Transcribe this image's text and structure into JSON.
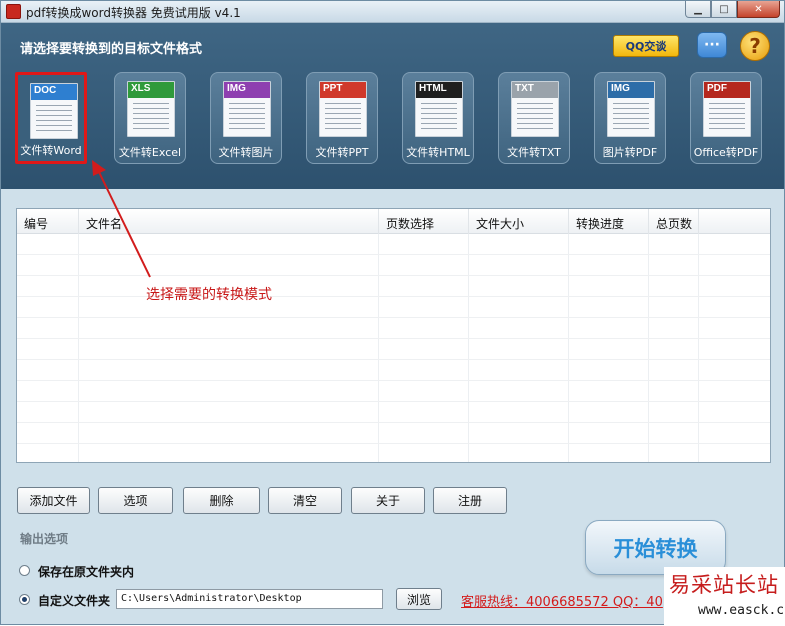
{
  "window": {
    "title": "pdf转换成word转换器 免费试用版 v4.1"
  },
  "header": {
    "title": "请选择要转换到的目标文件格式",
    "qq_chat_label": "QQ交谈",
    "chat_icon": "speech-bubble-icon",
    "help_icon": "question-icon"
  },
  "modes": [
    {
      "badge": "DOC",
      "label": "文件转Word",
      "selected": true,
      "band_color": "#2e7fd0"
    },
    {
      "badge": "XLS",
      "label": "文件转Excel",
      "selected": false,
      "band_color": "#2f9a3b"
    },
    {
      "badge": "IMG",
      "label": "文件转图片",
      "selected": false,
      "band_color": "#8e3fb0"
    },
    {
      "badge": "PPT",
      "label": "文件转PPT",
      "selected": false,
      "band_color": "#d0392b"
    },
    {
      "badge": "HTML",
      "label": "文件转HTML",
      "selected": false,
      "band_color": "#1f1f1f"
    },
    {
      "badge": "TXT",
      "label": "文件转TXT",
      "selected": false,
      "band_color": "#9aa3ab"
    },
    {
      "badge": "IMG",
      "label": "图片转PDF",
      "selected": false,
      "band_color": "#2d6da8"
    },
    {
      "badge": "PDF",
      "label": "Office转PDF",
      "selected": false,
      "band_color": "#b5281e"
    }
  ],
  "table": {
    "columns": [
      "编号",
      "文件名",
      "页数选择",
      "文件大小",
      "转换进度",
      "总页数"
    ],
    "rows": []
  },
  "annotation": "选择需要的转换模式",
  "buttons": {
    "add_file": "添加文件",
    "options": "选项",
    "delete": "删除",
    "clear": "清空",
    "about": "关于",
    "register": "注册",
    "browse": "浏览",
    "start": "开始转换"
  },
  "output": {
    "title": "输出选项",
    "option_original": "保存在原文件夹内",
    "option_custom": "自定义文件夹",
    "selected": "custom",
    "path": "C:\\Users\\Administrator\\Desktop"
  },
  "hotline": "客服热线：4006685572 QQ：40",
  "watermark": {
    "line1": "易采站长站",
    "line2": "www.easck.com"
  }
}
